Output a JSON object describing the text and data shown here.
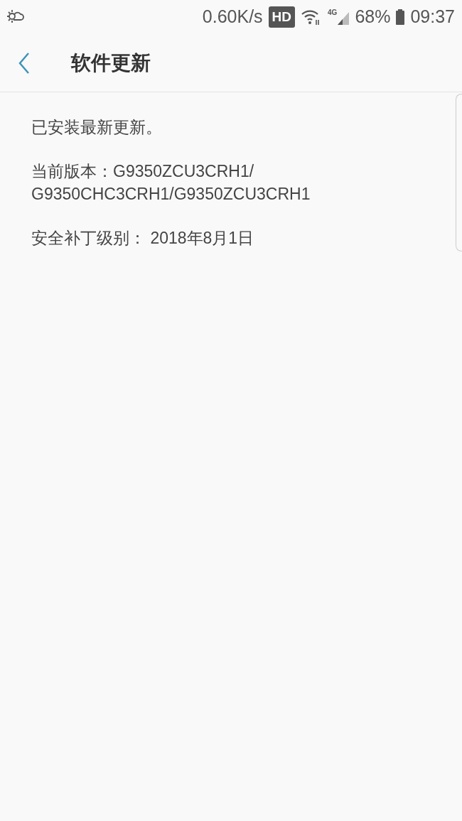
{
  "status_bar": {
    "net_speed": "0.60K/s",
    "hd_badge": "HD",
    "network": "4G",
    "battery": "68%",
    "time": "09:37"
  },
  "header": {
    "title": "软件更新"
  },
  "content": [
    {
      "kind": "text",
      "lines": [
        "已安装最新更新。"
      ]
    },
    {
      "kind": "text",
      "lines": [
        "当前版本：G9350ZCU3CRH1/",
        "G9350CHC3CRH1/G9350ZCU3CRH1"
      ]
    },
    {
      "kind": "text",
      "lines": [
        "安全补丁级别： 2018年8月1日"
      ]
    }
  ]
}
